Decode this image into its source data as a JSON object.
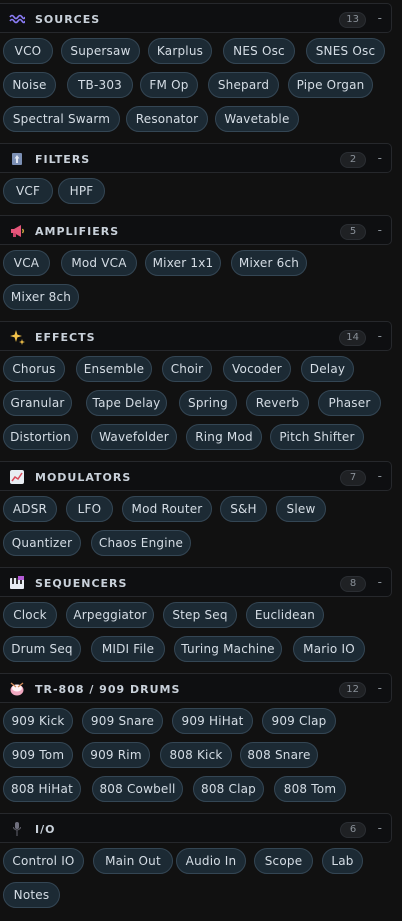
{
  "colors": {
    "background": "#111111",
    "header_bg": "#0e0f11",
    "chip_bg": "#1c2a34",
    "chip_border": "#344654",
    "chip_text": "#d5dde5",
    "section_title": "#c9d1da",
    "badge_text": "#8a9199"
  },
  "sections": [
    {
      "key": "sources",
      "title": "SOURCES",
      "count": "13",
      "collapse_label": "-",
      "icon": "wave-icon",
      "items": [
        "VCO",
        "Supersaw",
        "Karplus",
        "NES Osc",
        "SNES Osc",
        "Noise",
        "TB-303",
        "FM Op",
        "Shepard",
        "Pipe Organ",
        "Spectral Swarm",
        "Resonator",
        "Wavetable"
      ]
    },
    {
      "key": "filters",
      "title": "FILTERS",
      "count": "2",
      "collapse_label": "-",
      "icon": "filter-icon",
      "items": [
        "VCF",
        "HPF"
      ]
    },
    {
      "key": "amplifiers",
      "title": "AMPLIFIERS",
      "count": "5",
      "collapse_label": "-",
      "icon": "megaphone-icon",
      "items": [
        "VCA",
        "Mod VCA",
        "Mixer 1x1",
        "Mixer 6ch",
        "Mixer 8ch"
      ]
    },
    {
      "key": "effects",
      "title": "EFFECTS",
      "count": "14",
      "collapse_label": "-",
      "icon": "sparkles-icon",
      "items": [
        "Chorus",
        "Ensemble",
        "Choir",
        "Vocoder",
        "Delay",
        "Granular",
        "Tape Delay",
        "Spring",
        "Reverb",
        "Phaser",
        "Distortion",
        "Wavefolder",
        "Ring Mod",
        "Pitch Shifter"
      ]
    },
    {
      "key": "modulators",
      "title": "MODULATORS",
      "count": "7",
      "collapse_label": "-",
      "icon": "chart-up-icon",
      "items": [
        "ADSR",
        "LFO",
        "Mod Router",
        "S&H",
        "Slew",
        "Quantizer",
        "Chaos Engine"
      ]
    },
    {
      "key": "sequencers",
      "title": "SEQUENCERS",
      "count": "8",
      "collapse_label": "-",
      "icon": "keyboard-icon",
      "items": [
        "Clock",
        "Arpeggiator",
        "Step Seq",
        "Euclidean",
        "Drum Seq",
        "MIDI File",
        "Turing Machine",
        "Mario IO"
      ]
    },
    {
      "key": "drums",
      "title": "TR-808 / 909 DRUMS",
      "count": "12",
      "collapse_label": "-",
      "icon": "drum-icon",
      "items": [
        "909 Kick",
        "909 Snare",
        "909 HiHat",
        "909 Clap",
        "909 Tom",
        "909 Rim",
        "808 Kick",
        "808 Snare",
        "808 HiHat",
        "808 Cowbell",
        "808 Clap",
        "808 Tom"
      ]
    },
    {
      "key": "io",
      "title": "I/O",
      "count": "6",
      "collapse_label": "-",
      "icon": "microphone-icon",
      "items": [
        "Control IO",
        "Main Out",
        "Audio In",
        "Scope",
        "Lab",
        "Notes"
      ]
    }
  ]
}
